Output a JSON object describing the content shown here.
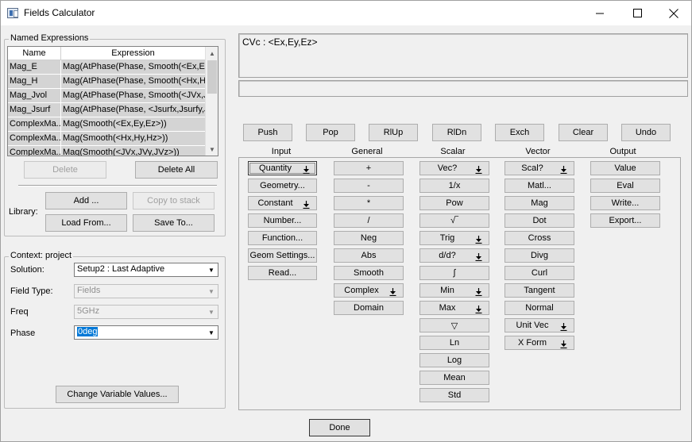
{
  "window": {
    "title": "Fields Calculator",
    "minimize_glyph": "—",
    "maximize_glyph": "☐",
    "close_glyph": "✕"
  },
  "named_expressions": {
    "group_label": "Named Expressions",
    "columns": [
      "Name",
      "Expression"
    ],
    "rows": [
      [
        "Mag_E",
        "Mag(AtPhase(Phase, Smooth(<Ex,E..."
      ],
      [
        "Mag_H",
        "Mag(AtPhase(Phase, Smooth(<Hx,H..."
      ],
      [
        "Mag_Jvol",
        "Mag(AtPhase(Phase, Smooth(<JVx,J..."
      ],
      [
        "Mag_Jsurf",
        "Mag(AtPhase(Phase, <Jsurfx,Jsurfy,J..."
      ],
      [
        "ComplexMa...",
        "Mag(Smooth(<Ex,Ey,Ez>))"
      ],
      [
        "ComplexMa...",
        "Mag(Smooth(<Hx,Hy,Hz>))"
      ],
      [
        "ComplexMa...",
        "Mag(Smooth(<JVx,JVy,JVz>))"
      ]
    ],
    "delete_label": "Delete",
    "delete_all_label": "Delete All",
    "library_label": "Library:",
    "add_label": "Add ...",
    "copy_to_stack_label": "Copy to stack",
    "load_from_label": "Load From...",
    "save_to_label": "Save To..."
  },
  "context": {
    "group_label": "Context: project",
    "solution_label": "Solution:",
    "solution_value": "Setup2 : Last Adaptive",
    "field_type_label": "Field Type:",
    "field_type_value": "Fields",
    "freq_label": "Freq",
    "freq_value": "5GHz",
    "phase_label": "Phase",
    "phase_value": "0deg",
    "change_vars_label": "Change Variable Values..."
  },
  "stack": {
    "top_line": "CVc : <Ex,Ey,Ez>"
  },
  "stack_buttons": [
    "Push",
    "Pop",
    "RlUp",
    "RlDn",
    "Exch",
    "Clear",
    "Undo"
  ],
  "column_headers": [
    "Input",
    "General",
    "Scalar",
    "Vector",
    "Output"
  ],
  "input_buttons": [
    {
      "label": "Quantity",
      "arrow": true
    },
    {
      "label": "Geometry...",
      "arrow": false
    },
    {
      "label": "Constant",
      "arrow": true
    },
    {
      "label": "Number...",
      "arrow": false
    },
    {
      "label": "Function...",
      "arrow": false
    },
    {
      "label": "Geom Settings...",
      "arrow": false
    },
    {
      "label": "Read...",
      "arrow": false
    }
  ],
  "general_buttons": [
    {
      "label": "+",
      "arrow": false
    },
    {
      "label": "-",
      "arrow": false
    },
    {
      "label": "*",
      "arrow": false
    },
    {
      "label": "/",
      "arrow": false
    },
    {
      "label": "Neg",
      "arrow": false
    },
    {
      "label": "Abs",
      "arrow": false
    },
    {
      "label": "Smooth",
      "arrow": false
    },
    {
      "label": "Complex",
      "arrow": true
    },
    {
      "label": "Domain",
      "arrow": false
    }
  ],
  "scalar_buttons": [
    {
      "label": "Vec?",
      "arrow": true
    },
    {
      "label": "1/x",
      "arrow": false
    },
    {
      "label": "Pow",
      "arrow": false
    },
    {
      "label": "√‾",
      "arrow": false
    },
    {
      "label": "Trig",
      "arrow": true
    },
    {
      "label": "d/d?",
      "arrow": true
    },
    {
      "label": "∫",
      "arrow": false
    },
    {
      "label": "Min",
      "arrow": true
    },
    {
      "label": "Max",
      "arrow": true
    },
    {
      "label": "▽",
      "arrow": false
    },
    {
      "label": "Ln",
      "arrow": false
    },
    {
      "label": "Log",
      "arrow": false
    },
    {
      "label": "Mean",
      "arrow": false
    },
    {
      "label": "Std",
      "arrow": false
    }
  ],
  "vector_buttons": [
    {
      "label": "Scal?",
      "arrow": true
    },
    {
      "label": "Matl...",
      "arrow": false
    },
    {
      "label": "Mag",
      "arrow": false
    },
    {
      "label": "Dot",
      "arrow": false
    },
    {
      "label": "Cross",
      "arrow": false
    },
    {
      "label": "Divg",
      "arrow": false
    },
    {
      "label": "Curl",
      "arrow": false
    },
    {
      "label": "Tangent",
      "arrow": false
    },
    {
      "label": "Normal",
      "arrow": false
    },
    {
      "label": "Unit Vec",
      "arrow": true
    },
    {
      "label": "X Form",
      "arrow": true
    }
  ],
  "output_buttons": [
    {
      "label": "Value",
      "arrow": false
    },
    {
      "label": "Eval",
      "arrow": false
    },
    {
      "label": "Write...",
      "arrow": false
    },
    {
      "label": "Export...",
      "arrow": false
    }
  ],
  "done_label": "Done",
  "icons": {
    "dropdown": "chevron-down-icon",
    "push_arrow": "download-arrow-icon"
  }
}
